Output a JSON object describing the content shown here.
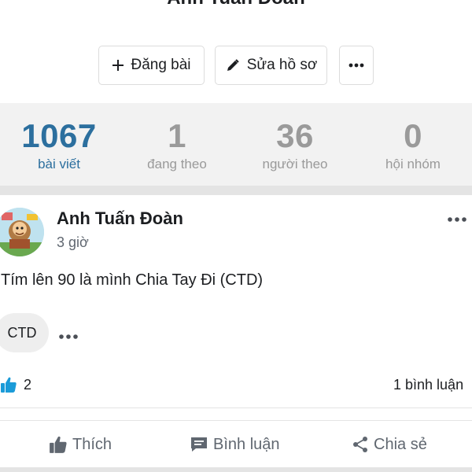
{
  "profile": {
    "name": "Anh Tuấn Đoàn"
  },
  "actions": {
    "post_label": "Đăng bài",
    "edit_label": "Sửa hồ sơ"
  },
  "stats": [
    {
      "value": "1067",
      "label": "bài viết"
    },
    {
      "value": "1",
      "label": "đang theo"
    },
    {
      "value": "36",
      "label": "người theo"
    },
    {
      "value": "0",
      "label": "hội nhóm"
    }
  ],
  "post": {
    "author": "Anh Tuấn Đoàn",
    "time": "3 giờ",
    "text": "Tím lên 90 là mình Chia Tay Đi (CTD)",
    "tag": "CTD",
    "like_count": "2",
    "comment_count": "1 bình luận"
  },
  "post_actions": {
    "like": "Thích",
    "comment": "Bình luận",
    "share": "Chia sẻ"
  },
  "colors": {
    "accent": "#2c6f9e",
    "muted": "#9a9a9a",
    "like_blue": "#1b9bd8"
  }
}
